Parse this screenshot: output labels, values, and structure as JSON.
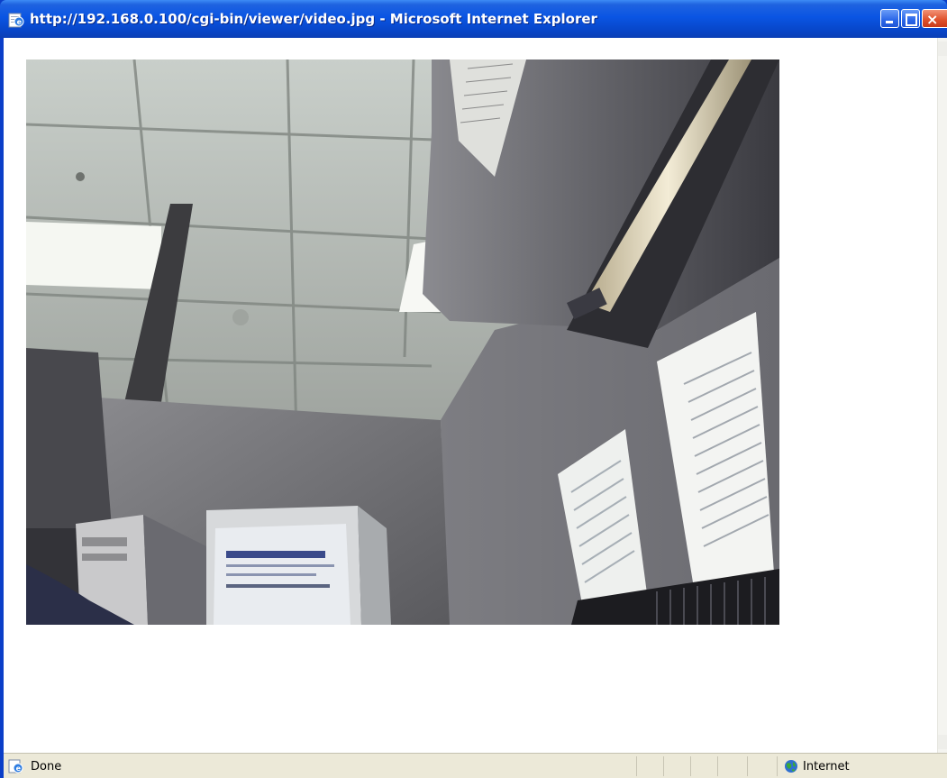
{
  "window": {
    "title": "http://192.168.0.100/cgi-bin/viewer/video.jpg - Microsoft Internet Explorer",
    "title_icon": "ie-page-icon",
    "controls": {
      "minimize": "minimize",
      "maximize": "maximize",
      "close": "×"
    }
  },
  "content": {
    "image_name": "video.jpg"
  },
  "statusbar": {
    "status_text": "Done",
    "zone_text": "Internet",
    "status_icon": "ie-page-icon",
    "zone_icon": "globe-icon"
  },
  "colors": {
    "titlebar": "#0a55e3",
    "close_button": "#e0532e",
    "statusbar": "#ece9d8"
  }
}
